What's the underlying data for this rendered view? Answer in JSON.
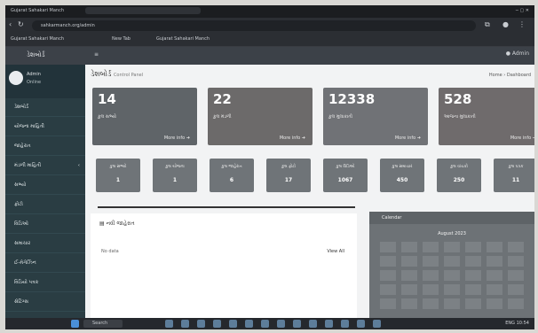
{
  "browser": {
    "tab_title": "Gujarat Sahakari Manch",
    "url": "sahkarmanch.org/admin",
    "bookmarks": [
      "Gujarat Sahakari Manch",
      "New Tab",
      "Gujarat Sahakari Manch"
    ]
  },
  "app": {
    "title": "ડેશબોર્ડ",
    "user_label": "Admin"
  },
  "sidebar": {
    "user_name": "Admin",
    "user_role": "Online",
    "items": [
      {
        "label": "ડેશબોર્ડ"
      },
      {
        "label": "યોજના માહિતી"
      },
      {
        "label": "જાહેરાત"
      },
      {
        "label": "મંડળી માહિતી",
        "arrow": "‹"
      },
      {
        "label": "સભ્યો"
      },
      {
        "label": "ફોટો"
      },
      {
        "label": "વિડિઓ"
      },
      {
        "label": "સમાચાર"
      },
      {
        "label": "ઈ-મેગેઝિન"
      },
      {
        "label": "વિડિયો પત્રક"
      },
      {
        "label": "સેટિંગ્સ"
      }
    ]
  },
  "page": {
    "title": "ડેશબોર્ડ",
    "subtitle": "Control Panel",
    "breadcrumb": "Home › Dashboard"
  },
  "stats": [
    {
      "value": "14",
      "label": "કુલ સભ્યો",
      "more": "More info",
      "color": "#5f6468"
    },
    {
      "value": "22",
      "label": "કુલ મંડળી",
      "more": "More info",
      "color": "#6c6a6a"
    },
    {
      "value": "12338",
      "label": "કુલ મુલાકાતી",
      "more": "More info",
      "color": "#707276"
    },
    {
      "value": "528",
      "label": "આજના મુલાકાતી",
      "more": "More info",
      "color": "#6f6b6c"
    }
  ],
  "small_stats": [
    {
      "label": "કુલ સભ્યો",
      "value": "1"
    },
    {
      "label": "કુલ યોજના",
      "value": "1"
    },
    {
      "label": "કુલ જાહેરાત",
      "value": "6"
    },
    {
      "label": "કુલ ફોટો",
      "value": "17"
    },
    {
      "label": "કુલ વિડિઓ",
      "value": "1067"
    },
    {
      "label": "કુલ સમાચાર",
      "value": "450"
    },
    {
      "label": "કુલ વાંચકો",
      "value": "250"
    },
    {
      "label": "કુલ પત્રક",
      "value": "11"
    }
  ],
  "news": {
    "title": "નવી જાહેરાત",
    "subtitle": "No data",
    "link": "View All"
  },
  "calendar": {
    "title": "Calendar",
    "month": "August 2023"
  },
  "taskbar": {
    "search_placeholder": "Search",
    "tray_text": "ENG 10:54"
  },
  "colors": {
    "sidebar": "#2a3d43",
    "header": "#3c4148",
    "main_bg": "#f2f3f4"
  }
}
